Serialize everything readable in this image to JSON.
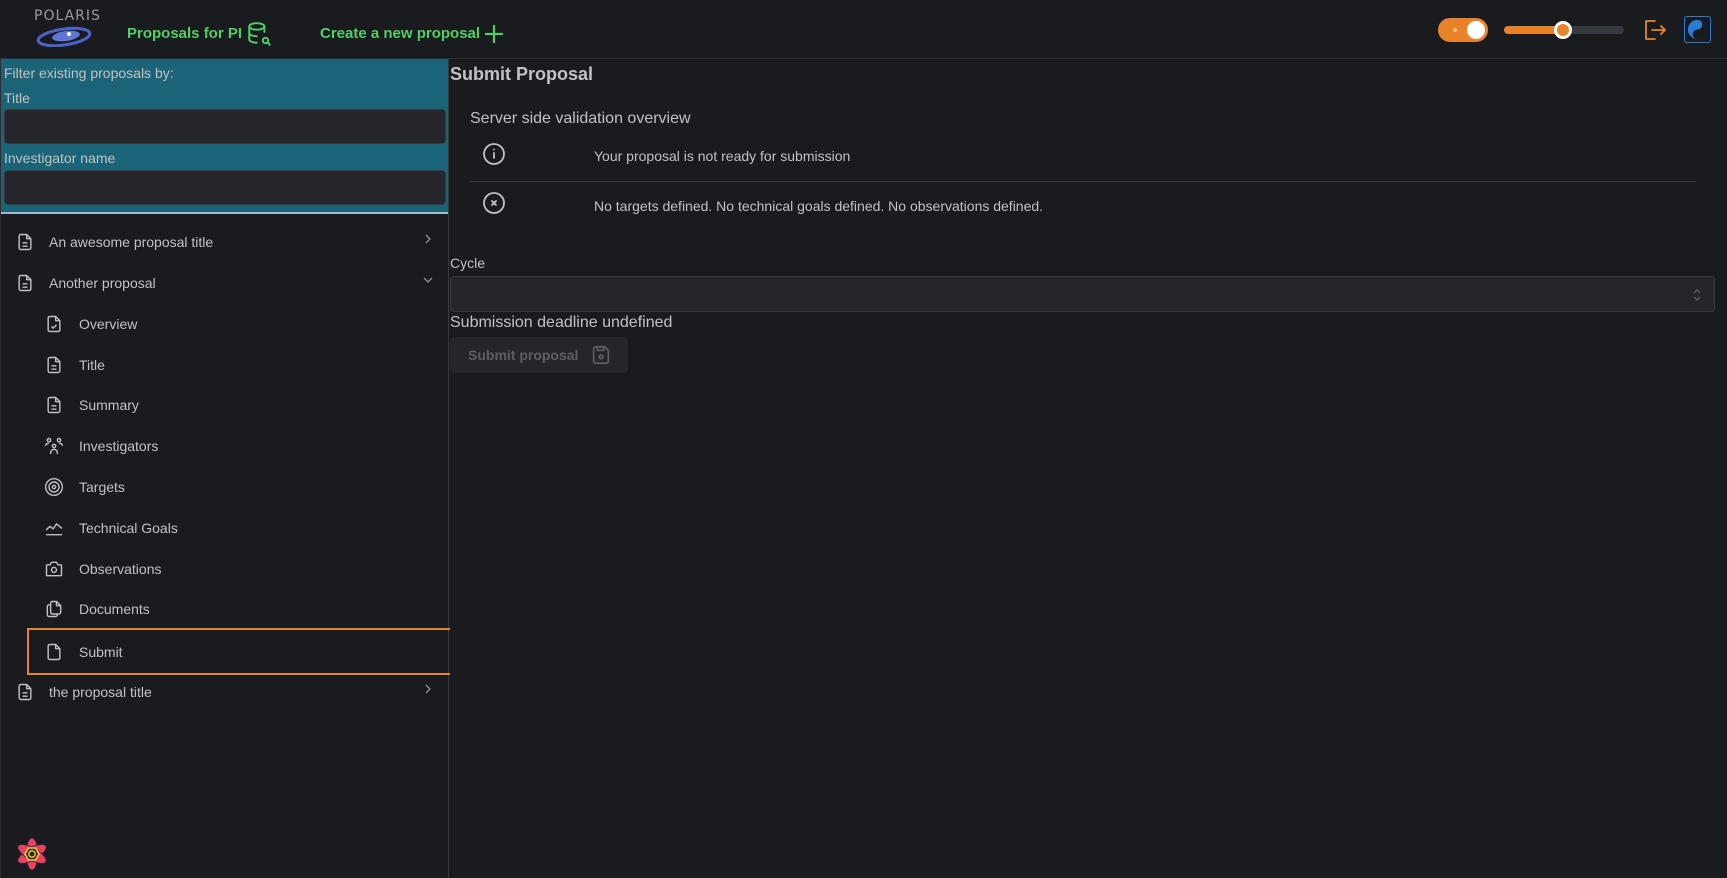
{
  "header": {
    "logo_text": "POLARIS",
    "nav": [
      {
        "label": "Proposals for PI",
        "icon": "database-search-icon"
      },
      {
        "label": "Create a new proposal",
        "icon": "plus-icon"
      }
    ],
    "theme_toggle": {
      "state": "on",
      "icon": "sun-icon"
    },
    "font_size_slider": {
      "value_fraction": 0.49
    },
    "logout_icon": "logout-icon",
    "theme_icon": "yin-yang-icon",
    "colors": {
      "accent": "#e8832a",
      "nav_green": "#51cf66",
      "blue": "#2a7bd4"
    }
  },
  "sidebar": {
    "filter": {
      "heading": "Filter existing proposals by:",
      "title_label": "Title",
      "title_value": "",
      "investigator_label": "Investigator name",
      "investigator_value": ""
    },
    "proposals": [
      {
        "label": "An awesome proposal title",
        "expanded": false
      },
      {
        "label": "Another proposal",
        "expanded": true,
        "children": [
          {
            "label": "Overview",
            "icon": "file-check-icon"
          },
          {
            "label": "Title",
            "icon": "file-text-icon"
          },
          {
            "label": "Summary",
            "icon": "file-text-icon"
          },
          {
            "label": "Investigators",
            "icon": "users-group-icon"
          },
          {
            "label": "Targets",
            "icon": "target-icon"
          },
          {
            "label": "Technical Goals",
            "icon": "chart-line-icon"
          },
          {
            "label": "Observations",
            "icon": "camera-icon"
          },
          {
            "label": "Documents",
            "icon": "files-icon"
          },
          {
            "label": "Submit",
            "icon": "file-icon",
            "active": true
          }
        ]
      },
      {
        "label": "the proposal title",
        "expanded": false
      }
    ],
    "footer_icon": "react-logo-icon"
  },
  "main": {
    "title": "Submit Proposal",
    "validation": {
      "heading": "Server side validation overview",
      "rows": [
        {
          "icon": "info-circle-icon",
          "text": "Your proposal is not ready for submission"
        },
        {
          "icon": "x-circle-icon",
          "text": "No targets defined. No technical goals defined. No observations defined."
        }
      ]
    },
    "cycle": {
      "label": "Cycle",
      "value": ""
    },
    "deadline_text": "Submission deadline undefined",
    "submit_button": {
      "label": "Submit proposal",
      "disabled": true
    }
  }
}
